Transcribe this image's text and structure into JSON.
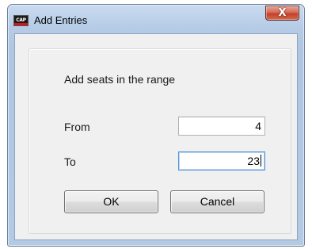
{
  "window": {
    "title": "Add Entries",
    "icon_label": "CAP",
    "close_glyph": "X",
    "icon": "app-icon"
  },
  "form": {
    "heading": "Add seats in the range",
    "from_label": "From",
    "from_value": "4",
    "to_label": "To",
    "to_value": "23"
  },
  "buttons": {
    "ok_label": "OK",
    "cancel_label": "Cancel"
  },
  "colors": {
    "titlebar": "#b5cbe6",
    "close_button": "#c2412a",
    "focus_border": "#5294d6",
    "client_bg": "#f0f0f0"
  }
}
